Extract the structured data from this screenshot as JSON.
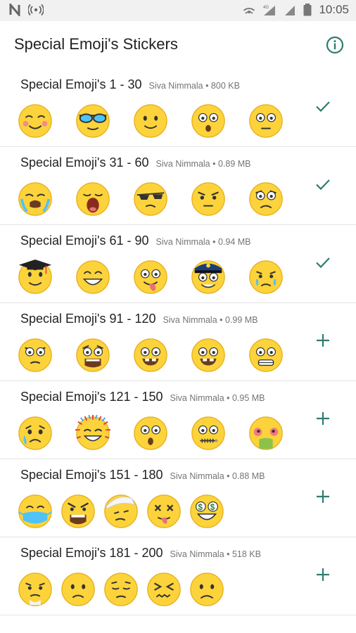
{
  "status_bar": {
    "time": "10:05"
  },
  "app_bar": {
    "title": "Special Emoji's Stickers"
  },
  "colors": {
    "accent": "#2e7d6e",
    "emoji_yellow": "#fcd33b",
    "emoji_outline": "#e8b020",
    "divider": "#e4e4e4"
  },
  "packs": [
    {
      "name": "Special Emoji's 1 - 30",
      "meta": "Siva Nimmala • 800 KB",
      "action": "added-check-icon",
      "stickers": [
        "blushing-smile",
        "sunglasses",
        "slight-smile",
        "surprised",
        "neutral"
      ]
    },
    {
      "name": "Special Emoji's 31 - 60",
      "meta": "Siva Nimmala • 0.89 MB",
      "action": "added-check-icon",
      "stickers": [
        "crying-loud",
        "yawning",
        "cool-smirk",
        "angry-mild",
        "frowning-worried"
      ]
    },
    {
      "name": "Special Emoji's 61 - 90",
      "meta": "Siva Nimmala • 0.94 MB",
      "action": "added-check-icon",
      "stickers": [
        "graduate",
        "big-smile",
        "tongue-out",
        "police",
        "sad-tear"
      ]
    },
    {
      "name": "Special Emoji's 91 - 120",
      "meta": "Siva Nimmala • 0.99 MB",
      "action": "add-plus-icon",
      "stickers": [
        "annoyed",
        "scared-screaming",
        "grinning-teeth",
        "grinning-teeth",
        "grimacing"
      ]
    },
    {
      "name": "Special Emoji's 121 - 150",
      "meta": "Siva Nimmala • 0.95 MB",
      "action": "add-plus-icon",
      "stickers": [
        "crying-sad",
        "exploding-head",
        "shocked",
        "zipper-mouth",
        "vomiting"
      ]
    },
    {
      "name": "Special Emoji's 151 - 180",
      "meta": "Siva Nimmala • 0.88 MB",
      "action": "add-plus-icon",
      "stickers": [
        "medical-mask",
        "angry-yelling",
        "bandaged-head",
        "dizzy",
        "money-eyes"
      ]
    },
    {
      "name": "Special Emoji's 181 - 200",
      "meta": "Siva Nimmala • 518 KB",
      "action": "add-plus-icon",
      "stickers": [
        "mouthless-breath",
        "frowning",
        "pensive",
        "tired-wince",
        "sad-frown"
      ]
    }
  ]
}
